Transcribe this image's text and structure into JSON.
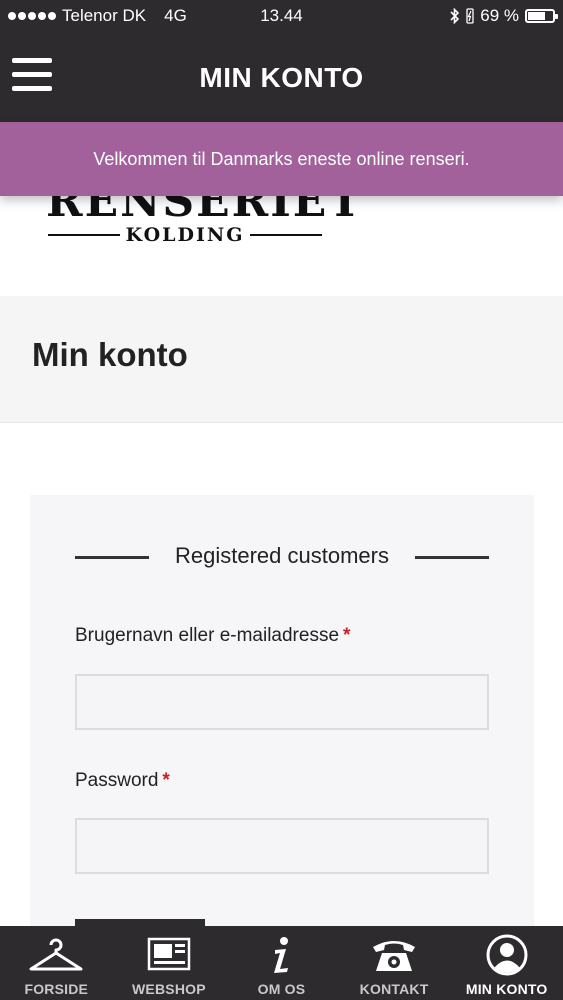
{
  "status_bar": {
    "carrier": "Telenor DK",
    "network": "4G",
    "time": "13.44",
    "battery": "69 %",
    "battery_level": 0.69
  },
  "header": {
    "title": "MIN KONTO"
  },
  "banner": {
    "text": "Velkommen til Danmarks eneste online renseri."
  },
  "logo": {
    "main": "RENSERIET",
    "sub": "KOLDING"
  },
  "page": {
    "title": "Min konto"
  },
  "login": {
    "section_title": "Registered customers",
    "username_label": "Brugernavn eller e-mailadresse",
    "password_label": "Password",
    "required_mark": "*",
    "username_value": "",
    "password_value": ""
  },
  "tabs": [
    {
      "label": "FORSIDE",
      "icon": "hanger-icon"
    },
    {
      "label": "WEBSHOP",
      "icon": "shop-icon"
    },
    {
      "label": "OM OS",
      "icon": "info-icon"
    },
    {
      "label": "KONTAKT",
      "icon": "phone-icon"
    },
    {
      "label": "MIN KONTO",
      "icon": "account-icon",
      "active": true
    }
  ],
  "colors": {
    "dark": "#2d2b2e",
    "banner": "#a3619c",
    "required": "#cc1f1f",
    "panel": "#f6f5f7"
  }
}
